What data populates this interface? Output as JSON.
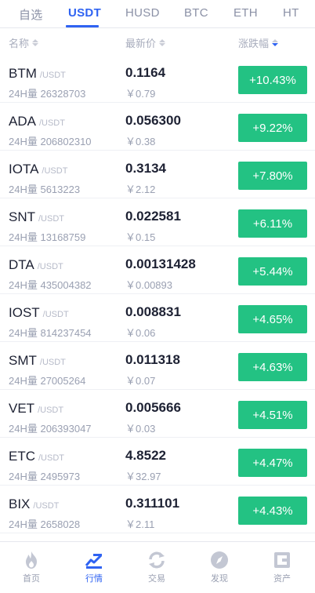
{
  "tabs": [
    "自选",
    "USDT",
    "HUSD",
    "BTC",
    "ETH",
    "HT"
  ],
  "header": {
    "name": "名称",
    "price": "最新价",
    "change": "涨跌幅"
  },
  "rows": [
    {
      "symbol": "BTM",
      "quote": "/USDT",
      "vol": "24H量 26328703",
      "price": "0.1164",
      "cny": "￥0.79",
      "change": "+10.43%"
    },
    {
      "symbol": "ADA",
      "quote": "/USDT",
      "vol": "24H量 206802310",
      "price": "0.056300",
      "cny": "￥0.38",
      "change": "+9.22%"
    },
    {
      "symbol": "IOTA",
      "quote": "/USDT",
      "vol": "24H量 5613223",
      "price": "0.3134",
      "cny": "￥2.12",
      "change": "+7.80%"
    },
    {
      "symbol": "SNT",
      "quote": "/USDT",
      "vol": "24H量 13168759",
      "price": "0.022581",
      "cny": "￥0.15",
      "change": "+6.11%"
    },
    {
      "symbol": "DTA",
      "quote": "/USDT",
      "vol": "24H量 435004382",
      "price": "0.00131428",
      "cny": "￥0.00893",
      "change": "+5.44%"
    },
    {
      "symbol": "IOST",
      "quote": "/USDT",
      "vol": "24H量 814237454",
      "price": "0.008831",
      "cny": "￥0.06",
      "change": "+4.65%"
    },
    {
      "symbol": "SMT",
      "quote": "/USDT",
      "vol": "24H量 27005264",
      "price": "0.011318",
      "cny": "￥0.07",
      "change": "+4.63%"
    },
    {
      "symbol": "VET",
      "quote": "/USDT",
      "vol": "24H量 206393047",
      "price": "0.005666",
      "cny": "￥0.03",
      "change": "+4.51%"
    },
    {
      "symbol": "ETC",
      "quote": "/USDT",
      "vol": "24H量 2495973",
      "price": "4.8522",
      "cny": "￥32.97",
      "change": "+4.47%"
    },
    {
      "symbol": "BIX",
      "quote": "/USDT",
      "vol": "24H量 2658028",
      "price": "0.311101",
      "cny": "￥2.11",
      "change": "+4.43%"
    }
  ],
  "nav": [
    {
      "label": "首页",
      "icon": "flame-icon"
    },
    {
      "label": "行情",
      "icon": "market-icon"
    },
    {
      "label": "交易",
      "icon": "exchange-icon"
    },
    {
      "label": "发现",
      "icon": "compass-icon"
    },
    {
      "label": "资产",
      "icon": "wallet-icon"
    }
  ],
  "colors": {
    "accent": "#2f63f2",
    "up": "#23c283"
  }
}
